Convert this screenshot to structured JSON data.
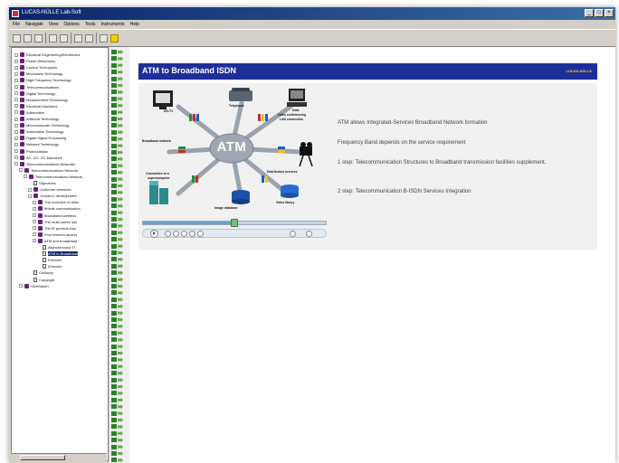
{
  "window": {
    "title": "LUCAS-NÜLLE Lab-Soft"
  },
  "menu": [
    "File",
    "Navigate",
    "View",
    "Options",
    "Tools",
    "Instruments",
    "Help"
  ],
  "toolbar": [
    "open-icon",
    "save-icon",
    "print-icon",
    "up-icon",
    "down-icon",
    "back-icon",
    "forward-icon",
    "exit-icon",
    "star-icon"
  ],
  "tree": {
    "items": [
      {
        "label": "Electrical Engineering/Electronics",
        "indent": 0,
        "icon": "book"
      },
      {
        "label": "Power Electronics",
        "indent": 0,
        "icon": "book"
      },
      {
        "label": "Control Techniques",
        "indent": 0,
        "icon": "book"
      },
      {
        "label": "Microwave Technology",
        "indent": 0,
        "icon": "book"
      },
      {
        "label": "High Frequency Technology",
        "indent": 0,
        "icon": "book"
      },
      {
        "label": "Telecommunications",
        "indent": 0,
        "icon": "book"
      },
      {
        "label": "Digital Technology",
        "indent": 0,
        "icon": "book"
      },
      {
        "label": "Measurement Technology",
        "indent": 0,
        "icon": "book"
      },
      {
        "label": "Electrical Machines",
        "indent": 0,
        "icon": "book"
      },
      {
        "label": "Automotive",
        "indent": 0,
        "icon": "book"
      },
      {
        "label": "Antenna Technology",
        "indent": 0,
        "icon": "book"
      },
      {
        "label": "Microcomputer Technology",
        "indent": 0,
        "icon": "book"
      },
      {
        "label": "Automation Technology",
        "indent": 0,
        "icon": "book"
      },
      {
        "label": "Digital Signal Processing",
        "indent": 0,
        "icon": "book"
      },
      {
        "label": "Network Technology",
        "indent": 0,
        "icon": "book"
      },
      {
        "label": "Photovoltaics",
        "indent": 0,
        "icon": "book"
      },
      {
        "label": "AC, DC, DC Machines",
        "indent": 0,
        "icon": "book"
      },
      {
        "label": "Telecommunications Networks",
        "indent": 0,
        "icon": "book"
      },
      {
        "label": "Telecommunications Network",
        "indent": 1,
        "icon": "book"
      },
      {
        "label": "Telecommunications Network",
        "indent": 2,
        "icon": "book"
      },
      {
        "label": "Objectives",
        "indent": 3,
        "icon": "page"
      },
      {
        "label": "Customer networks",
        "indent": 3,
        "icon": "book"
      },
      {
        "label": "Trends in development",
        "indent": 3,
        "icon": "book"
      },
      {
        "label": "The evolution of netw",
        "indent": 4,
        "icon": "book"
      },
      {
        "label": "Mobile communication",
        "indent": 4,
        "icon": "book"
      },
      {
        "label": "Broadband wireless",
        "indent": 4,
        "icon": "book"
      },
      {
        "label": "The multi-carrier sys",
        "indent": 4,
        "icon": "book"
      },
      {
        "label": "The IP protocol tran",
        "indent": 4,
        "icon": "book"
      },
      {
        "label": "Post Internet access",
        "indent": 4,
        "icon": "book"
      },
      {
        "label": "ATM and broadband",
        "indent": 4,
        "icon": "book"
      },
      {
        "label": "Asynchronous Tr",
        "indent": 5,
        "icon": "page"
      },
      {
        "label": "ATM to Broadband",
        "indent": 5,
        "icon": "page",
        "selected": true
      },
      {
        "label": "Exercise",
        "indent": 5,
        "icon": "page"
      },
      {
        "label": "Exercise",
        "indent": 5,
        "icon": "page"
      },
      {
        "label": "Glossary",
        "indent": 3,
        "icon": "page"
      },
      {
        "label": "Copyright",
        "indent": 3,
        "icon": "page"
      },
      {
        "label": "SDH/Ideen",
        "indent": 1,
        "icon": "book"
      }
    ]
  },
  "content": {
    "title": "ATM to Broadband ISDN",
    "logo": "LUCAS-NÜLLE",
    "diagram": {
      "center": "ATM",
      "labels": {
        "hdtv": "HD-TV",
        "telephone": "Telephone",
        "data": "Data",
        "video_conf": "video conferencing",
        "lan": "LAN connection",
        "broadband": "Broadband network",
        "distribution": "Distribution services",
        "connection": "Connection to a",
        "supercomputer": "supercomputer",
        "image_db": "Image database",
        "video_library": "Video library"
      }
    },
    "steps": [
      "ATM allows Integrated-Services Broadband Network formation",
      "Frequency Band depends on the service requirement",
      "1 step: Telecommunication Structures to Broadband transmission facilities supplement.",
      "2 step: Telecommunication B-ISDN Services Integration"
    ],
    "player": {
      "progress": 0.5
    }
  },
  "colors": {
    "header_bg": "#1d2e99",
    "title_bar": "#0a246a",
    "atm_star": "#9fa8b2"
  }
}
